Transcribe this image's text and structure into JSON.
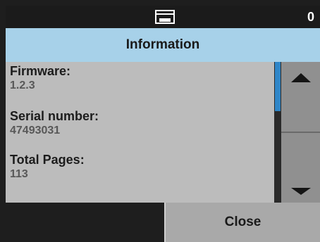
{
  "status_bar": {
    "icon": "scanner-icon",
    "count": "0"
  },
  "header": {
    "title": "Information"
  },
  "info": {
    "items": [
      {
        "label": "Firmware:",
        "value": "1.2.3"
      },
      {
        "label": "Serial number:",
        "value": "47493031"
      },
      {
        "label": "Total Pages:",
        "value": "113"
      }
    ]
  },
  "scroll": {
    "up_icon": "arrow-up-icon",
    "down_icon": "arrow-down-icon",
    "position": 0
  },
  "footer": {
    "close_label": "Close"
  },
  "colors": {
    "header_bg": "#a7d1e9",
    "panel_bg": "#bcbcbc",
    "scroll_thumb": "#2e86c8",
    "button_bg": "#a9a9a9",
    "background": "#1e1e1e"
  }
}
